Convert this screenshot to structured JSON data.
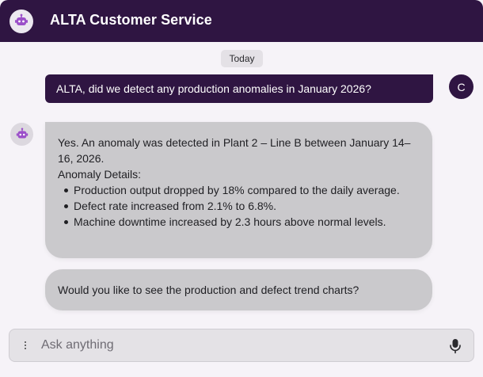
{
  "header": {
    "title": "ALTA Customer Service",
    "avatar_icon": "robot-icon"
  },
  "chat": {
    "date_label": "Today",
    "user_message": {
      "avatar_initial": "C",
      "text": "ALTA, did we detect any production anomalies in January 2026?"
    },
    "bot_avatar_icon": "robot-icon",
    "bot_messages": [
      {
        "intro": "Yes. An anomaly was detected in Plant 2 – Line B between January 14–16, 2026.",
        "details_heading": "Anomaly Details:",
        "bullets": [
          "Production output dropped by 18% compared to the daily average.",
          "Defect rate increased from 2.1% to 6.8%.",
          "Machine downtime increased by 2.3 hours above normal levels."
        ]
      },
      {
        "text": "Would you like to see the production and defect trend charts?"
      }
    ]
  },
  "composer": {
    "placeholder": "Ask anything",
    "value": "",
    "menu_icon": "more-vertical-icon",
    "mic_icon": "microphone-icon"
  },
  "colors": {
    "brand": "#2f1542",
    "background": "#f6f3f8",
    "bot_bubble": "#cac9cc",
    "robot_accent": "#9b4fc9"
  }
}
